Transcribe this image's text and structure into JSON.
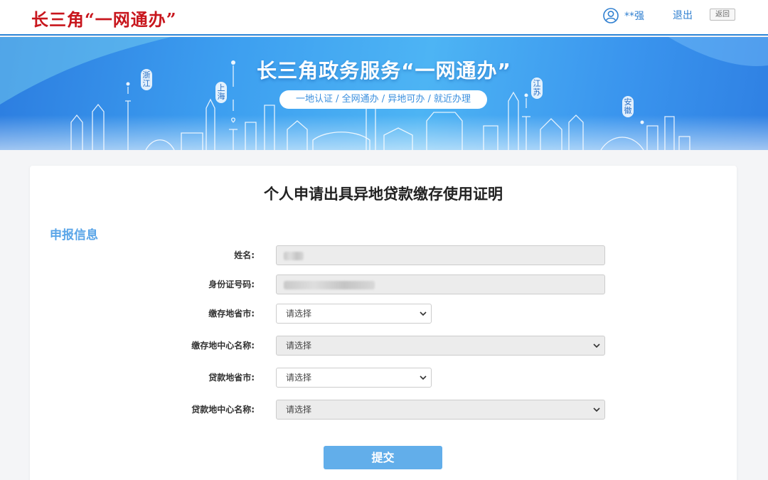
{
  "header": {
    "logo": "长三角“一网通办”",
    "user_name": "**强",
    "logout_label": "退出",
    "back_label": "返回"
  },
  "banner": {
    "title": "长三角政务服务“一网通办”",
    "slogan": "一地认证 / 全网通办 / 异地可办 / 就近办理",
    "tags": [
      "浙江",
      "上海",
      "江苏",
      "安徽"
    ]
  },
  "form": {
    "page_title": "个人申请出具异地贷款缴存使用证明",
    "section_title": "申报信息",
    "fields": [
      {
        "label": "姓名:",
        "type": "text",
        "value": ""
      },
      {
        "label": "身份证号码:",
        "type": "text",
        "value": ""
      },
      {
        "label": "缴存地省市:",
        "type": "select",
        "value": "请选择"
      },
      {
        "label": "缴存地中心名称:",
        "type": "select",
        "value": "请选择"
      },
      {
        "label": "贷款地省市:",
        "type": "select",
        "value": "请选择"
      },
      {
        "label": "贷款地中心名称:",
        "type": "select",
        "value": "请选择"
      }
    ],
    "submit_label": "提交"
  },
  "colors": {
    "brand_red": "#c8161d",
    "accent_blue": "#2f7fd0",
    "section_blue": "#5aa5e8",
    "button_blue": "#62aeea"
  },
  "icons": [
    "user-icon",
    "chevron-down-icon"
  ]
}
